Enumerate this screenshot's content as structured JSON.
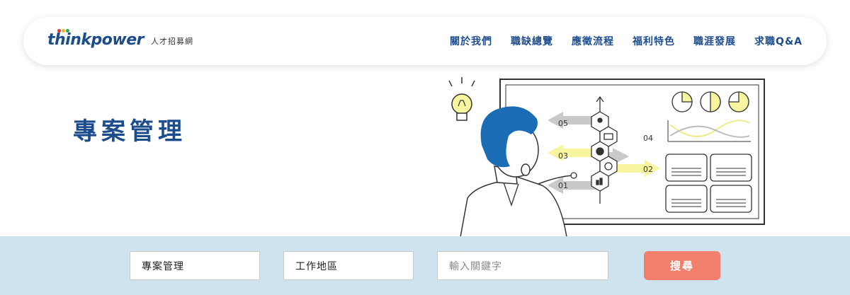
{
  "logo": {
    "word": "thinkpower",
    "subtitle": "人才招募網",
    "dot_colors": [
      "#e8332a",
      "#f2b21b",
      "#3aa648"
    ]
  },
  "nav": {
    "items": [
      {
        "label": "關於我們"
      },
      {
        "label": "職缺總覽"
      },
      {
        "label": "應徵流程"
      },
      {
        "label": "福利特色"
      },
      {
        "label": "職涯發展"
      },
      {
        "label": "求職Q&A"
      }
    ]
  },
  "hero": {
    "title": "專案管理"
  },
  "illustration": {
    "step_labels": [
      "05",
      "04",
      "03",
      "02",
      "01"
    ]
  },
  "search": {
    "category_value": "專案管理",
    "location_value": "工作地區",
    "keyword_placeholder": "輸入關鍵字",
    "button_label": "搜尋"
  },
  "colors": {
    "brand": "#1c4c8c",
    "search_bg": "#cfe3ef",
    "button": "#f07f6c",
    "accent_yellow": "#f7f5a0",
    "hair_blue": "#1a6db5"
  }
}
